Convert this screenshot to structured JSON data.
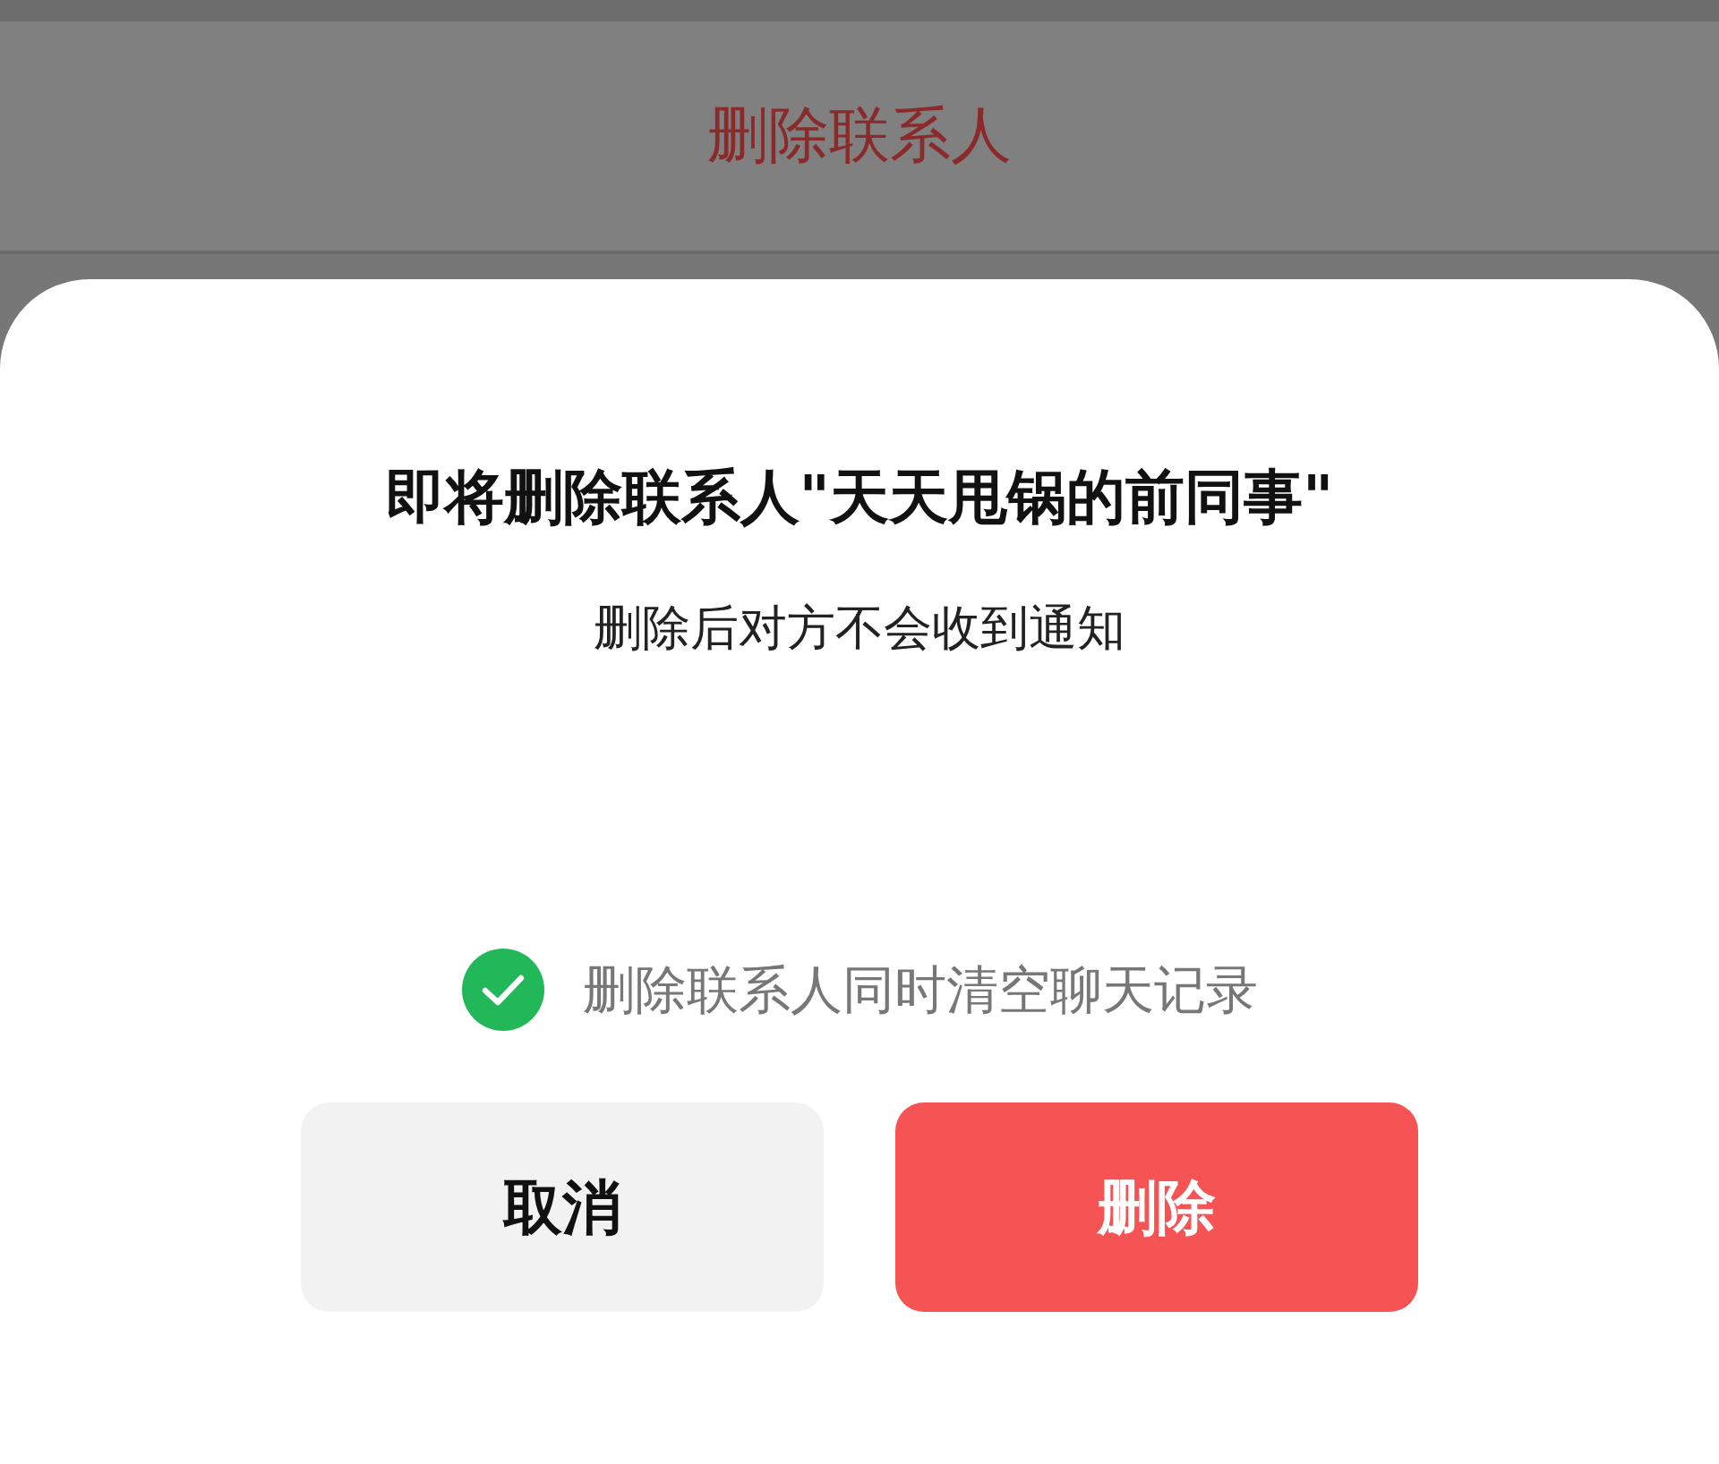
{
  "backdrop": {
    "menu_item": "删除联系人"
  },
  "dialog": {
    "title": "即将删除联系人\"天天甩锅的前同事\"",
    "message": "删除后对方不会收到通知",
    "option": {
      "label": "删除联系人同时清空聊天记录",
      "checked": true
    },
    "buttons": [
      {
        "label": "取消",
        "kind": "cancel"
      },
      {
        "label": "删除",
        "kind": "destructive"
      }
    ]
  }
}
